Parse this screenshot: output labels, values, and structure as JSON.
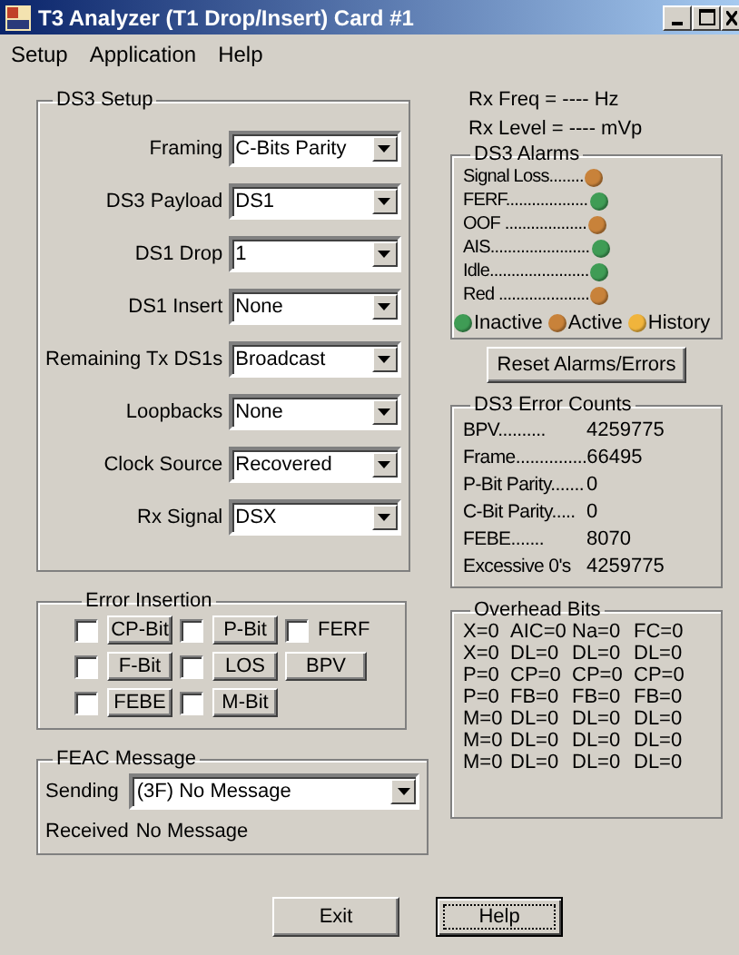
{
  "window": {
    "title": "T3 Analyzer (T1 Drop/Insert) Card #1"
  },
  "menu": [
    {
      "label": "Setup"
    },
    {
      "label": "Application"
    },
    {
      "label": "Help"
    }
  ],
  "ds3_setup": {
    "title": "DS3 Setup",
    "fields": [
      {
        "label": "Framing",
        "value": "C-Bits Parity"
      },
      {
        "label": "DS3 Payload",
        "value": "DS1"
      },
      {
        "label": "DS1 Drop",
        "value": "1"
      },
      {
        "label": "DS1 Insert",
        "value": "None"
      },
      {
        "label": "Remaining Tx DS1s",
        "value": "Broadcast"
      },
      {
        "label": "Loopbacks",
        "value": "None"
      },
      {
        "label": "Clock Source",
        "value": "Recovered"
      },
      {
        "label": "Rx Signal",
        "value": "DSX"
      }
    ]
  },
  "error_insertion": {
    "title": "Error Insertion",
    "items": [
      {
        "kind": "toggle",
        "label": "CP-Bit",
        "checked": false
      },
      {
        "kind": "toggle",
        "label": "P-Bit",
        "checked": false
      },
      {
        "kind": "check",
        "label": "FERF",
        "checked": false
      },
      {
        "kind": "toggle",
        "label": "F-Bit",
        "checked": false
      },
      {
        "kind": "toggle",
        "label": "LOS",
        "checked": false
      },
      {
        "kind": "button",
        "label": "BPV"
      },
      {
        "kind": "toggle",
        "label": "FEBE",
        "checked": false
      },
      {
        "kind": "toggle",
        "label": "M-Bit",
        "checked": false
      }
    ]
  },
  "feac": {
    "title": "FEAC Message",
    "sending_label": "Sending",
    "sending_value": "(3F) No Message",
    "received_label": "Received",
    "received_value": "No Message"
  },
  "rx_freq": "Rx Freq = ---- Hz",
  "rx_level": "Rx Level = ---- mVp",
  "ds3_alarms": {
    "title": "DS3 Alarms",
    "items": [
      {
        "label": "Signal Loss........",
        "color": "#c8823a"
      },
      {
        "label": "FERF...................",
        "color": "#3f9c55"
      },
      {
        "label": "OOF ...................",
        "color": "#c8823a"
      },
      {
        "label": "AIS.......................",
        "color": "#3f9c55"
      },
      {
        "label": "Idle.......................",
        "color": "#3f9c55"
      },
      {
        "label": "Red .....................",
        "color": "#c8823a"
      }
    ],
    "legend": [
      {
        "label": "Inactive",
        "color": "#3f9c55"
      },
      {
        "label": "Active",
        "color": "#c8823a"
      },
      {
        "label": "History",
        "color": "#f0b43c"
      }
    ]
  },
  "reset_button": "Reset Alarms/Errors",
  "error_counts": {
    "title": "DS3 Error Counts",
    "rows": [
      {
        "label": "BPV..........",
        "value": "4259775"
      },
      {
        "label": "Frame...............",
        "value": "66495"
      },
      {
        "label": "P-Bit Parity.......",
        "value": "0"
      },
      {
        "label": "C-Bit Parity.....",
        "value": "0"
      },
      {
        "label": "FEBE.......",
        "value": "8070"
      },
      {
        "label": "Excessive 0's",
        "value": "4259775"
      }
    ]
  },
  "overhead_bits": {
    "title": "Overhead Bits",
    "rows": [
      [
        "X=0",
        "AIC=0",
        "Na=0",
        "FC=0"
      ],
      [
        "X=0",
        "DL=0",
        "DL=0",
        "DL=0"
      ],
      [
        "P=0",
        "CP=0",
        "CP=0",
        "CP=0"
      ],
      [
        "P=0",
        "FB=0",
        "FB=0",
        "FB=0"
      ],
      [
        "M=0",
        "DL=0",
        "DL=0",
        "DL=0"
      ],
      [
        "M=0",
        "DL=0",
        "DL=0",
        "DL=0"
      ],
      [
        "M=0",
        "DL=0",
        "DL=0",
        "DL=0"
      ]
    ]
  },
  "buttons": [
    {
      "label": "Exit",
      "focused": false
    },
    {
      "label": "Help",
      "focused": true
    }
  ]
}
